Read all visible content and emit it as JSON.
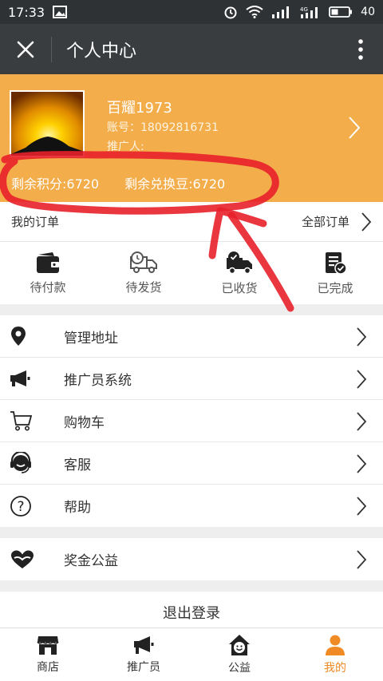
{
  "status": {
    "time": "17:33",
    "network": "4G",
    "battery": "40"
  },
  "header": {
    "title": "个人中心"
  },
  "profile": {
    "name": "百耀1973",
    "account": "账号：18092816731",
    "promoter": "推广人:",
    "points": "剩余积分:6720",
    "beans": "剩余兑换豆:6720"
  },
  "orders": {
    "title": "我的订单",
    "all": "全部订单",
    "items": [
      {
        "label": "待付款",
        "icon": "wallet-icon"
      },
      {
        "label": "待发货",
        "icon": "delivery-clock-icon"
      },
      {
        "label": "已收货",
        "icon": "truck-check-icon"
      },
      {
        "label": "已完成",
        "icon": "clipboard-check-icon"
      }
    ]
  },
  "menu": [
    {
      "label": "管理地址",
      "icon": "location-pin-icon"
    },
    {
      "label": "推广员系统",
      "icon": "megaphone-icon"
    },
    {
      "label": "购物车",
      "icon": "cart-icon"
    },
    {
      "label": "客服",
      "icon": "headset-icon"
    },
    {
      "label": "帮助",
      "icon": "help-icon"
    }
  ],
  "charity": {
    "label": "奖金公益",
    "icon": "heart-hands-icon"
  },
  "logout": "退出登录",
  "tabs": [
    {
      "label": "商店",
      "icon": "store-icon"
    },
    {
      "label": "推广员",
      "icon": "megaphone-icon"
    },
    {
      "label": "公益",
      "icon": "smile-house-icon"
    },
    {
      "label": "我的",
      "icon": "person-icon"
    }
  ],
  "colors": {
    "accent": "#f3ad4a",
    "active_tab": "#f08a24",
    "annotation": "#e8202a"
  }
}
